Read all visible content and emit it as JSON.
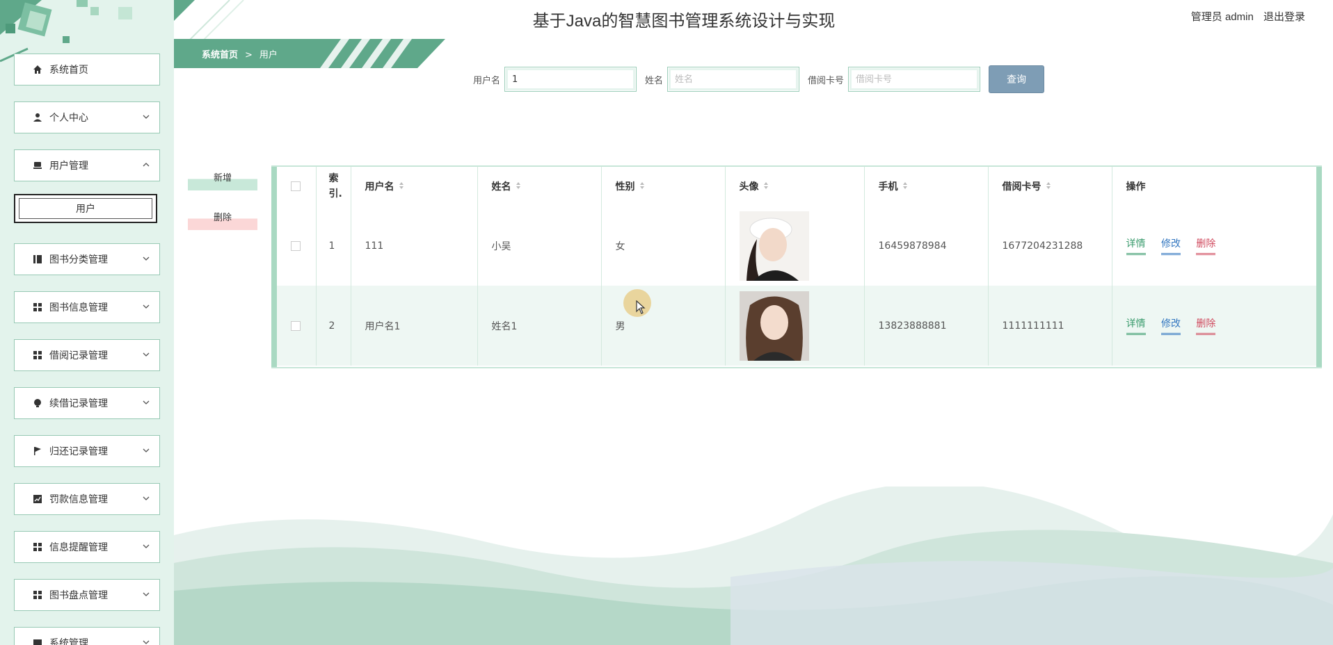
{
  "header": {
    "title": "基于Java的智慧图书管理系统设计与实现",
    "user_label": "管理员 admin",
    "logout_label": "退出登录"
  },
  "sidebar": {
    "items": [
      {
        "label": "系统首页",
        "icon": "home-icon"
      },
      {
        "label": "个人中心",
        "icon": "user-icon"
      },
      {
        "label": "用户管理",
        "icon": "users-icon"
      },
      {
        "label": "图书分类管理",
        "icon": "book-icon"
      },
      {
        "label": "图书信息管理",
        "icon": "grid-icon"
      },
      {
        "label": "借阅记录管理",
        "icon": "grid-icon"
      },
      {
        "label": "续借记录管理",
        "icon": "bulb-icon"
      },
      {
        "label": "归还记录管理",
        "icon": "flag-icon"
      },
      {
        "label": "罚款信息管理",
        "icon": "chart-icon"
      },
      {
        "label": "信息提醒管理",
        "icon": "grid-icon"
      },
      {
        "label": "图书盘点管理",
        "icon": "grid-icon"
      },
      {
        "label": "系统管理",
        "icon": "system-icon"
      }
    ],
    "sub_item_label": "用户"
  },
  "breadcrumb": {
    "home": "系统首页",
    "separator": ">",
    "current": "用户"
  },
  "search": {
    "username_label": "用户名",
    "username_value": "1",
    "username_placeholder": "用户名",
    "name_label": "姓名",
    "name_placeholder": "姓名",
    "card_label": "借阅卡号",
    "card_placeholder": "借阅卡号",
    "button_label": "查询"
  },
  "actions": {
    "add_label": "新增",
    "delete_label": "删除"
  },
  "table": {
    "headers": {
      "index": "索引.",
      "username": "用户名",
      "name": "姓名",
      "gender": "性别",
      "avatar": "头像",
      "phone": "手机",
      "card": "借阅卡号",
      "ops": "操作"
    },
    "rows": [
      {
        "index": "1",
        "username": "111",
        "name": "小吴",
        "gender": "女",
        "phone": "16459878984",
        "card": "1677204231288"
      },
      {
        "index": "2",
        "username": "用户名1",
        "name": "姓名1",
        "gender": "男",
        "phone": "13823888881",
        "card": "1111111111"
      }
    ],
    "op_labels": {
      "detail": "详情",
      "edit": "修改",
      "delete": "删除"
    }
  },
  "colors": {
    "accent": "#5fa88a",
    "sidebar_bg": "#e3f3ec",
    "search_button": "#7e9db5",
    "delete_red": "#d04b5f",
    "edit_blue": "#3377c0"
  }
}
